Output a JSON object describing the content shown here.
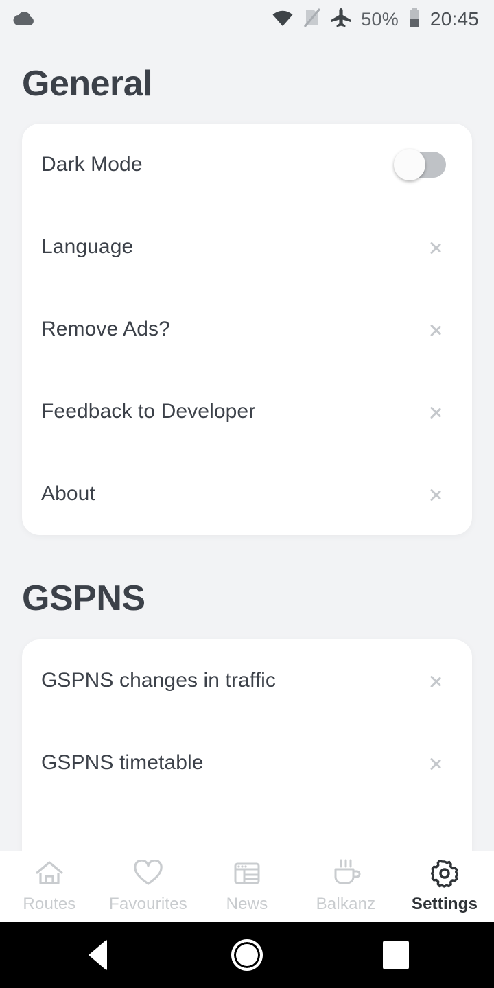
{
  "statusbar": {
    "left_icons": [
      {
        "name": "cloud-icon",
        "glyph": "cloud"
      }
    ],
    "wifi_icon": "wifi-icon",
    "no_sim_icon": "no-sim-icon",
    "airplane_icon": "airplane-mode-icon",
    "battery_percent": "50%",
    "battery_icon": "battery-half-icon",
    "clock": "20:45"
  },
  "sections": [
    {
      "title": "General",
      "rows": [
        {
          "label": "Dark Mode",
          "control": "toggle",
          "value": "off"
        },
        {
          "label": "Language",
          "control": "chevron"
        },
        {
          "label": "Remove Ads?",
          "control": "chevron"
        },
        {
          "label": "Feedback to Developer",
          "control": "chevron"
        },
        {
          "label": "About",
          "control": "chevron"
        }
      ]
    },
    {
      "title": "GSPNS",
      "rows": [
        {
          "label": "GSPNS changes in traffic",
          "control": "chevron"
        },
        {
          "label": "GSPNS timetable",
          "control": "chevron"
        }
      ]
    }
  ],
  "bottomnav": {
    "items": [
      {
        "label": "Routes",
        "icon": "home-icon",
        "active": false
      },
      {
        "label": "Favourites",
        "icon": "heart-icon",
        "active": false
      },
      {
        "label": "News",
        "icon": "newspaper-icon",
        "active": false
      },
      {
        "label": "Balkanz",
        "icon": "coffee-cup-icon",
        "active": false
      },
      {
        "label": "Settings",
        "icon": "gear-icon",
        "active": true
      }
    ]
  },
  "androidnav": {
    "back": "back-button",
    "home": "home-button",
    "recents": "recents-button"
  },
  "colors": {
    "background": "#f2f3f5",
    "card": "#ffffff",
    "text_primary": "#3c4149",
    "text_muted": "#c9cccf",
    "chevron": "#c5c8cc",
    "toggle_track": "#bfc2c6"
  }
}
